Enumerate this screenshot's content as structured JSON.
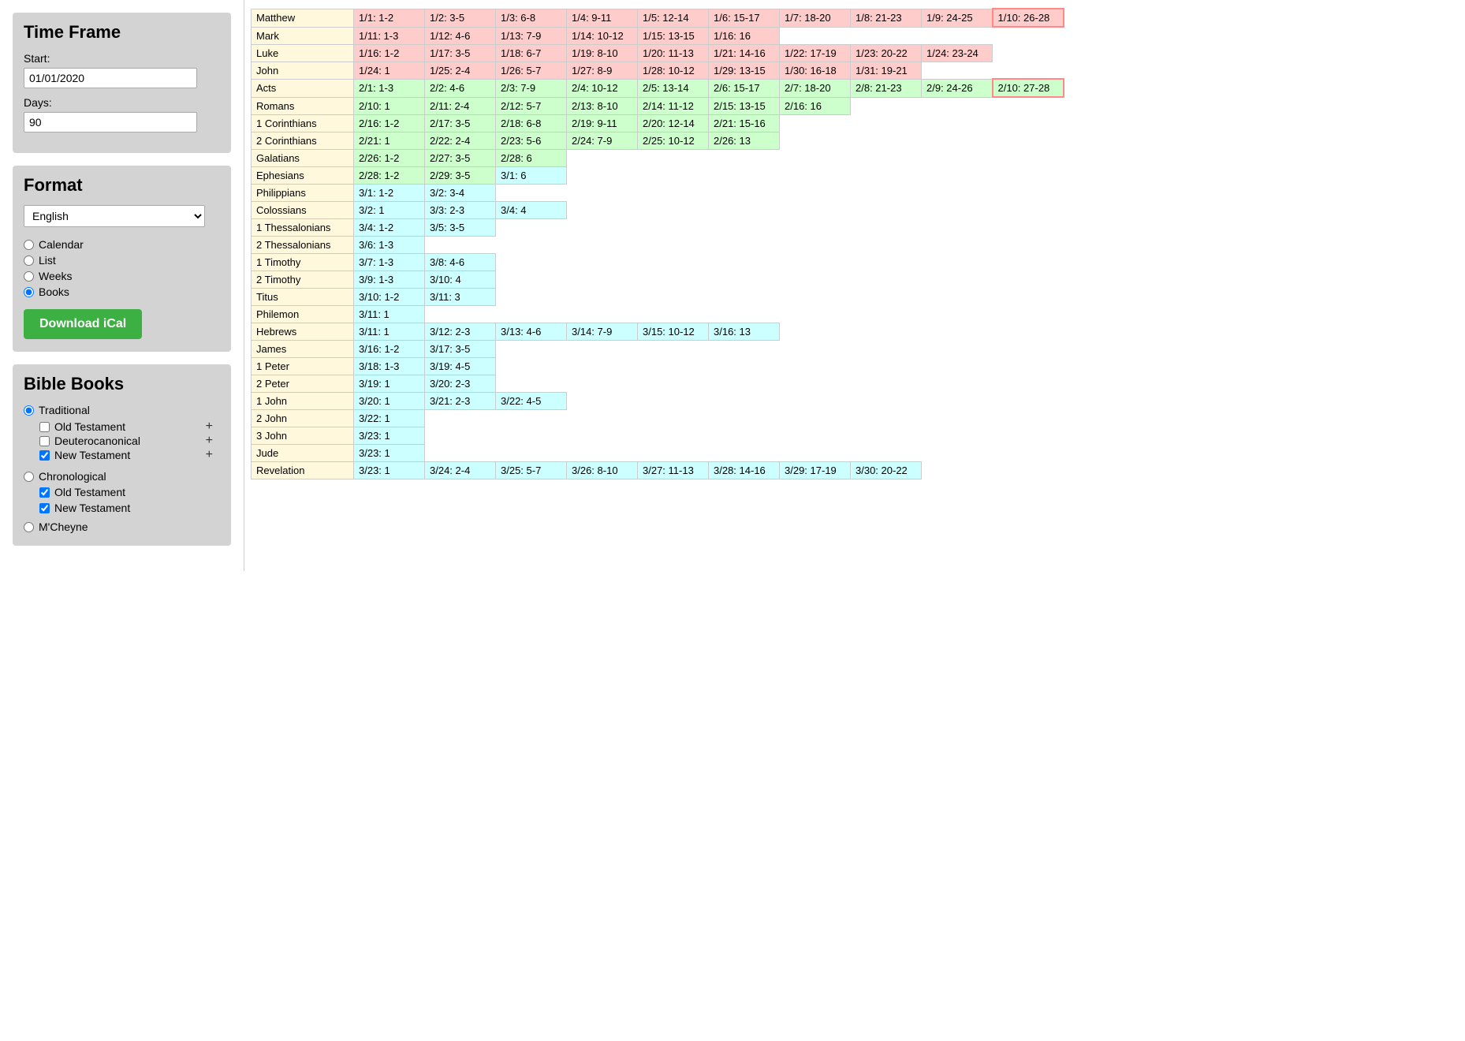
{
  "sidebar": {
    "timeframe_title": "Time Frame",
    "start_label": "Start:",
    "start_value": "01/01/2020",
    "days_label": "Days:",
    "days_value": "90",
    "format_title": "Format",
    "format_language": "English",
    "format_options": [
      "Calendar",
      "List",
      "Weeks",
      "Books"
    ],
    "format_selected": "Books",
    "download_label": "Download iCal",
    "bible_books_title": "Bible Books",
    "traditional_label": "Traditional",
    "trad_ot_label": "Old Testament",
    "trad_deut_label": "Deuterocanonical",
    "trad_nt_label": "New Testament",
    "chrono_label": "Chronological",
    "chrono_ot_label": "Old Testament",
    "chrono_nt_label": "New Testament",
    "mcheyne_label": "M'Cheyne"
  },
  "books": [
    {
      "name": "Matthew",
      "readings": [
        {
          "date": "1/1: 1-2",
          "month": 1
        },
        {
          "date": "1/2: 3-5",
          "month": 1
        },
        {
          "date": "1/3: 6-8",
          "month": 1
        },
        {
          "date": "1/4: 9-11",
          "month": 1
        },
        {
          "date": "1/5: 12-14",
          "month": 1
        },
        {
          "date": "1/6: 15-17",
          "month": 1
        },
        {
          "date": "1/7: 18-20",
          "month": 1
        },
        {
          "date": "1/8: 21-23",
          "month": 1
        },
        {
          "date": "1/9: 24-25",
          "month": 1
        },
        {
          "date": "1/10: 26-28",
          "month": 1,
          "outlined": true
        }
      ]
    },
    {
      "name": "Mark",
      "readings": [
        {
          "date": "1/11: 1-3",
          "month": 1
        },
        {
          "date": "1/12: 4-6",
          "month": 1
        },
        {
          "date": "1/13: 7-9",
          "month": 1
        },
        {
          "date": "1/14: 10-12",
          "month": 1
        },
        {
          "date": "1/15: 13-15",
          "month": 1
        },
        {
          "date": "1/16: 16",
          "month": 1
        }
      ]
    },
    {
      "name": "Luke",
      "readings": [
        {
          "date": "1/16: 1-2",
          "month": 1
        },
        {
          "date": "1/17: 3-5",
          "month": 1
        },
        {
          "date": "1/18: 6-7",
          "month": 1
        },
        {
          "date": "1/19: 8-10",
          "month": 1
        },
        {
          "date": "1/20: 11-13",
          "month": 1
        },
        {
          "date": "1/21: 14-16",
          "month": 1
        },
        {
          "date": "1/22: 17-19",
          "month": 1
        },
        {
          "date": "1/23: 20-22",
          "month": 1
        },
        {
          "date": "1/24: 23-24",
          "month": 1
        }
      ]
    },
    {
      "name": "John",
      "readings": [
        {
          "date": "1/24: 1",
          "month": 1
        },
        {
          "date": "1/25: 2-4",
          "month": 1
        },
        {
          "date": "1/26: 5-7",
          "month": 1
        },
        {
          "date": "1/27: 8-9",
          "month": 1
        },
        {
          "date": "1/28: 10-12",
          "month": 1
        },
        {
          "date": "1/29: 13-15",
          "month": 1
        },
        {
          "date": "1/30: 16-18",
          "month": 1
        },
        {
          "date": "1/31: 19-21",
          "month": 1
        }
      ]
    },
    {
      "name": "Acts",
      "readings": [
        {
          "date": "2/1: 1-3",
          "month": 2
        },
        {
          "date": "2/2: 4-6",
          "month": 2
        },
        {
          "date": "2/3: 7-9",
          "month": 2
        },
        {
          "date": "2/4: 10-12",
          "month": 2
        },
        {
          "date": "2/5: 13-14",
          "month": 2
        },
        {
          "date": "2/6: 15-17",
          "month": 2
        },
        {
          "date": "2/7: 18-20",
          "month": 2
        },
        {
          "date": "2/8: 21-23",
          "month": 2
        },
        {
          "date": "2/9: 24-26",
          "month": 2
        },
        {
          "date": "2/10: 27-28",
          "month": 2,
          "outlined": true
        }
      ]
    },
    {
      "name": "Romans",
      "readings": [
        {
          "date": "2/10: 1",
          "month": 2
        },
        {
          "date": "2/11: 2-4",
          "month": 2
        },
        {
          "date": "2/12: 5-7",
          "month": 2
        },
        {
          "date": "2/13: 8-10",
          "month": 2
        },
        {
          "date": "2/14: 11-12",
          "month": 2
        },
        {
          "date": "2/15: 13-15",
          "month": 2
        },
        {
          "date": "2/16: 16",
          "month": 2
        }
      ]
    },
    {
      "name": "1 Corinthians",
      "readings": [
        {
          "date": "2/16: 1-2",
          "month": 2
        },
        {
          "date": "2/17: 3-5",
          "month": 2
        },
        {
          "date": "2/18: 6-8",
          "month": 2
        },
        {
          "date": "2/19: 9-11",
          "month": 2
        },
        {
          "date": "2/20: 12-14",
          "month": 2
        },
        {
          "date": "2/21: 15-16",
          "month": 2
        }
      ]
    },
    {
      "name": "2 Corinthians",
      "readings": [
        {
          "date": "2/21: 1",
          "month": 2
        },
        {
          "date": "2/22: 2-4",
          "month": 2
        },
        {
          "date": "2/23: 5-6",
          "month": 2
        },
        {
          "date": "2/24: 7-9",
          "month": 2
        },
        {
          "date": "2/25: 10-12",
          "month": 2
        },
        {
          "date": "2/26: 13",
          "month": 2
        }
      ]
    },
    {
      "name": "Galatians",
      "readings": [
        {
          "date": "2/26: 1-2",
          "month": 2
        },
        {
          "date": "2/27: 3-5",
          "month": 2
        },
        {
          "date": "2/28: 6",
          "month": 2
        }
      ]
    },
    {
      "name": "Ephesians",
      "readings": [
        {
          "date": "2/28: 1-2",
          "month": 2
        },
        {
          "date": "2/29: 3-5",
          "month": 2
        },
        {
          "date": "3/1: 6",
          "month": 3
        }
      ]
    },
    {
      "name": "Philippians",
      "readings": [
        {
          "date": "3/1: 1-2",
          "month": 3
        },
        {
          "date": "3/2: 3-4",
          "month": 3
        }
      ]
    },
    {
      "name": "Colossians",
      "readings": [
        {
          "date": "3/2: 1",
          "month": 3
        },
        {
          "date": "3/3: 2-3",
          "month": 3
        },
        {
          "date": "3/4: 4",
          "month": 3
        }
      ]
    },
    {
      "name": "1 Thessalonians",
      "readings": [
        {
          "date": "3/4: 1-2",
          "month": 3
        },
        {
          "date": "3/5: 3-5",
          "month": 3
        }
      ]
    },
    {
      "name": "2 Thessalonians",
      "readings": [
        {
          "date": "3/6: 1-3",
          "month": 3
        }
      ]
    },
    {
      "name": "1 Timothy",
      "readings": [
        {
          "date": "3/7: 1-3",
          "month": 3
        },
        {
          "date": "3/8: 4-6",
          "month": 3
        }
      ]
    },
    {
      "name": "2 Timothy",
      "readings": [
        {
          "date": "3/9: 1-3",
          "month": 3
        },
        {
          "date": "3/10: 4",
          "month": 3
        }
      ]
    },
    {
      "name": "Titus",
      "readings": [
        {
          "date": "3/10: 1-2",
          "month": 3
        },
        {
          "date": "3/11: 3",
          "month": 3
        }
      ]
    },
    {
      "name": "Philemon",
      "readings": [
        {
          "date": "3/11: 1",
          "month": 3
        }
      ]
    },
    {
      "name": "Hebrews",
      "readings": [
        {
          "date": "3/11: 1",
          "month": 3
        },
        {
          "date": "3/12: 2-3",
          "month": 3
        },
        {
          "date": "3/13: 4-6",
          "month": 3
        },
        {
          "date": "3/14: 7-9",
          "month": 3
        },
        {
          "date": "3/15: 10-12",
          "month": 3
        },
        {
          "date": "3/16: 13",
          "month": 3
        }
      ]
    },
    {
      "name": "James",
      "readings": [
        {
          "date": "3/16: 1-2",
          "month": 3
        },
        {
          "date": "3/17: 3-5",
          "month": 3
        }
      ]
    },
    {
      "name": "1 Peter",
      "readings": [
        {
          "date": "3/18: 1-3",
          "month": 3
        },
        {
          "date": "3/19: 4-5",
          "month": 3
        }
      ]
    },
    {
      "name": "2 Peter",
      "readings": [
        {
          "date": "3/19: 1",
          "month": 3
        },
        {
          "date": "3/20: 2-3",
          "month": 3
        }
      ]
    },
    {
      "name": "1 John",
      "readings": [
        {
          "date": "3/20: 1",
          "month": 3
        },
        {
          "date": "3/21: 2-3",
          "month": 3
        },
        {
          "date": "3/22: 4-5",
          "month": 3
        }
      ]
    },
    {
      "name": "2 John",
      "readings": [
        {
          "date": "3/22: 1",
          "month": 3
        }
      ]
    },
    {
      "name": "3 John",
      "readings": [
        {
          "date": "3/23: 1",
          "month": 3
        }
      ]
    },
    {
      "name": "Jude",
      "readings": [
        {
          "date": "3/23: 1",
          "month": 3
        }
      ]
    },
    {
      "name": "Revelation",
      "readings": [
        {
          "date": "3/23: 1",
          "month": 3
        },
        {
          "date": "3/24: 2-4",
          "month": 3
        },
        {
          "date": "3/25: 5-7",
          "month": 3
        },
        {
          "date": "3/26: 8-10",
          "month": 3
        },
        {
          "date": "3/27: 11-13",
          "month": 3
        },
        {
          "date": "3/28: 14-16",
          "month": 3
        },
        {
          "date": "3/29: 17-19",
          "month": 3
        },
        {
          "date": "3/30: 20-22",
          "month": 3
        }
      ]
    }
  ]
}
